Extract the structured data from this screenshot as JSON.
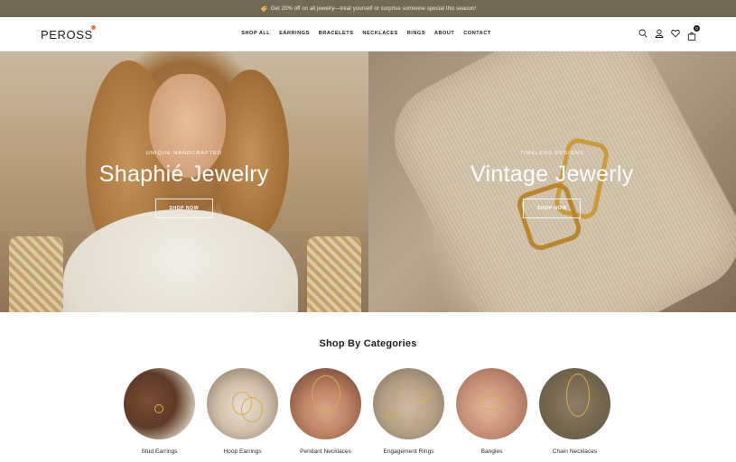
{
  "announcement": {
    "text": "Get 20% off on all jewelry—treat yourself or surprise someone special this season!",
    "icon": "tag-icon"
  },
  "header": {
    "logo": "PEROSS",
    "nav": [
      "SHOP ALL",
      "EARRINGS",
      "BRACELETS",
      "NECKLACES",
      "RINGS",
      "ABOUT",
      "CONTACT"
    ],
    "icons": [
      "search-icon",
      "account-icon",
      "wishlist-heart-icon",
      "cart-bag-icon"
    ],
    "cart_count": "0"
  },
  "hero": [
    {
      "eyebrow": "UNIQUE HANDCRAFTED",
      "title": "Shaphié Jewelry",
      "button": "SHOP NOW"
    },
    {
      "eyebrow": "TIMELESS DESIGNS",
      "title": "Vintage Jewerly",
      "button": "SHOP NOW"
    }
  ],
  "categories": {
    "title": "Shop By Categories",
    "items": [
      "Stud Earrings",
      "Hoop Earrings",
      "Pendant Necklaces",
      "Engagement Rings",
      "Bangles",
      "Chain Necklaces"
    ]
  },
  "colors": {
    "announcement_bg": "#726a56",
    "text_dark": "#1c1c1c",
    "logo_accent": "#e07b52"
  }
}
